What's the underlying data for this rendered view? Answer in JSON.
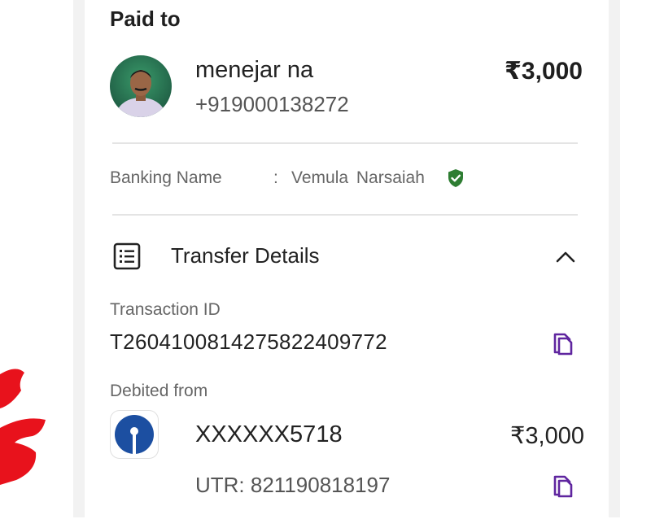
{
  "header": {
    "title": "Paid to"
  },
  "payee": {
    "name": "menejar na",
    "phone": "+919000138272",
    "amount": "₹3,000"
  },
  "banking": {
    "label": "Banking Name",
    "colon": ":",
    "value": "Vemula  Narsaiah"
  },
  "transfer": {
    "title": "Transfer Details",
    "transaction_id_label": "Transaction ID",
    "transaction_id": "T2604100814275822409772",
    "debited_from_label": "Debited from",
    "account": "XXXXXX5718",
    "amount": "₹3,000",
    "utr": "UTR: 821190818197"
  },
  "icons": {
    "verified": "shield-check-icon",
    "transfer": "receipt-list-icon",
    "expand": "chevron-up-icon",
    "copy": "copy-icon",
    "bank": "bank-logo-icon"
  },
  "colors": {
    "accent": "#5f259f",
    "verified": "#2e7d32",
    "bank_logo": "#1c4fa1",
    "scribble": "#e8121c"
  }
}
